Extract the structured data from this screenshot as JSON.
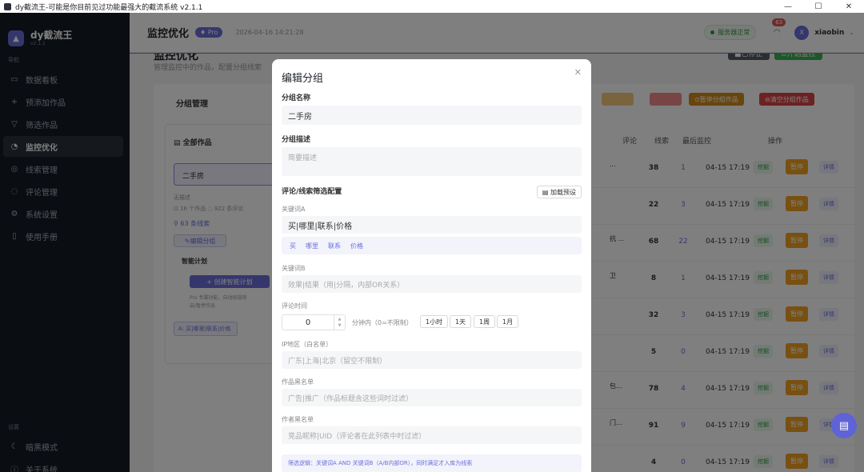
{
  "window": {
    "title": "dy截流王-可能是你目前见过功能最强大的截流系统 v2.1.1",
    "min": "—",
    "max": "☐",
    "close": "✕"
  },
  "sidebar": {
    "brand": "dy截流王",
    "version": "v2.1.1",
    "nav_section": "导航",
    "items": [
      {
        "label": "数据看板",
        "icon": "dashboard-icon",
        "glyph": "▭"
      },
      {
        "label": "预添加作品",
        "icon": "plus-icon",
        "glyph": "+"
      },
      {
        "label": "筛选作品",
        "icon": "filter-icon",
        "glyph": "▽"
      },
      {
        "label": "监控优化",
        "icon": "gauge-icon",
        "glyph": "◔"
      },
      {
        "label": "线索管理",
        "icon": "target-icon",
        "glyph": "◎"
      },
      {
        "label": "评论管理",
        "icon": "comment-icon",
        "glyph": "◌"
      },
      {
        "label": "系统设置",
        "icon": "gear-icon",
        "glyph": "⚙"
      },
      {
        "label": "使用手册",
        "icon": "book-icon",
        "glyph": "▯"
      }
    ],
    "settings_section": "设置",
    "bottom_items": [
      {
        "label": "暗黑模式",
        "icon": "moon-icon",
        "glyph": "☾"
      },
      {
        "label": "关于系统",
        "icon": "info-icon",
        "glyph": "ⓘ"
      }
    ]
  },
  "header": {
    "title": "监控优化",
    "pro_badge": "Pro",
    "datetime": "2026-04-16 14:21:28",
    "server_status": "服务器正常",
    "notif_count": "63",
    "username": "xiaobin",
    "avatar_letter": "X"
  },
  "background": {
    "section_title": "监控优化",
    "section_sub": "管理监控中的作品，配置分组线索",
    "btn_stopped": "■已停止",
    "btn_start": "⊙开始监控",
    "card_title": "分组管理",
    "btn_pause_group": "⊙暂停分组作品",
    "btn_clear_group": "⊖清空分组作品",
    "all_works": "全部作品",
    "group_name": "二手房",
    "no_desc": "无描述",
    "stats": "⊡ 16 个作品   ◌ 922 条评论",
    "clues": "⚲ 63 条线索",
    "edit_group": "✎编辑分组",
    "smart_plan": "智能计划",
    "create_plan": "+ 创建智能计划",
    "plan_note_1": "Pro 专属功能，自动按规则",
    "plan_note_2": "启/暂停作品",
    "kw_tag": "A: 买|哪里|联系|价格",
    "col_comments": "评论",
    "col_clues": "线索",
    "col_last": "最后监控",
    "col_ops": "操作",
    "rows": [
      {
        "trunc": "...",
        "comments": "38",
        "clues": "1",
        "last": "04-15 17:19"
      },
      {
        "trunc": "",
        "comments": "22",
        "clues": "3",
        "last": "04-15 17:19"
      },
      {
        "trunc": "抗 ...",
        "comments": "68",
        "clues": "22",
        "last": "04-15 17:19"
      },
      {
        "trunc": "卫",
        "comments": "8",
        "clues": "1",
        "last": "04-15 17:19"
      },
      {
        "trunc": "",
        "comments": "32",
        "clues": "3",
        "last": "04-15 17:19"
      },
      {
        "trunc": "",
        "comments": "5",
        "clues": "0",
        "last": "04-15 17:19"
      },
      {
        "trunc": "包...",
        "comments": "78",
        "clues": "4",
        "last": "04-15 17:19"
      },
      {
        "trunc": "门...",
        "comments": "91",
        "clues": "9",
        "last": "04-15 17:19"
      },
      {
        "trunc": "",
        "comments": "4",
        "clues": "0",
        "last": "04-15 17:19"
      }
    ],
    "tag_dig": "挖掘",
    "tag_pause": "暂停",
    "tag_detail": "详情"
  },
  "modal": {
    "title": "编辑分组",
    "close": "✕",
    "name_label": "分组名称",
    "name_value": "二手房",
    "desc_label": "分组描述",
    "desc_placeholder": "简要描述",
    "filter_label": "评论/线索筛选配置",
    "load_preset": "▤ 加载预设",
    "kwA_label": "关键词A",
    "kwA_value": "买|哪里|联系|价格",
    "kwA_tags": [
      "买",
      "哪里",
      "联系",
      "价格"
    ],
    "kwB_label": "关键词B",
    "kwB_placeholder": "效果|结果（用|分隔，内部OR关系）",
    "time_label": "评论时间",
    "time_value": "0",
    "time_unit": "分钟内（0=不限制）",
    "quick": [
      "1小时",
      "1天",
      "1周",
      "1月"
    ],
    "ip_label": "IP地区（白名单）",
    "ip_placeholder": "广东|上海|北京（留空不限制）",
    "works_black_label": "作品黑名单",
    "works_black_placeholder": "广告|推广（作品标题含这些词时过滤）",
    "author_black_label": "作者黑名单",
    "author_black_placeholder": "竞品昵称|UID（评论者在此列表中时过滤）",
    "logic_note": "筛选逻辑：关键词A AND 关键词B（A/B内部OR），同时满足才入库为线索"
  },
  "colors": {
    "accent": "#6b6fd9",
    "sidebar": "#141a24",
    "pause": "#f0a020",
    "success": "#2e9a48",
    "danger": "#e05454"
  }
}
